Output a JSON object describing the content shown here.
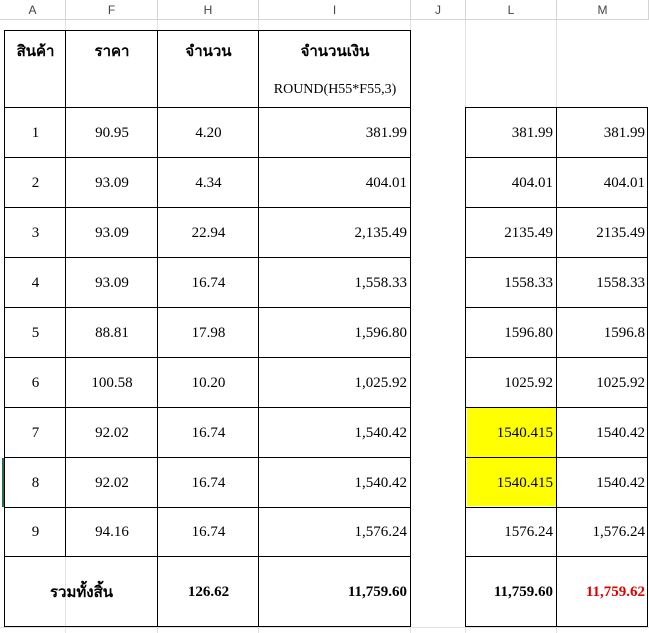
{
  "column_headers": [
    "A",
    "F",
    "H",
    "I",
    "J",
    "L",
    "M"
  ],
  "table": {
    "headers": {
      "product": "สินค้า",
      "price": "ราคา",
      "quantity": "จำนวน",
      "amount": "จำนวนเงิน",
      "formula_note": "ROUND(H55*F55,3)"
    },
    "rows": [
      {
        "item": "1",
        "price": "90.95",
        "qty": "4.20",
        "amount": "381.99",
        "l": "381.99",
        "m": "381.99"
      },
      {
        "item": "2",
        "price": "93.09",
        "qty": "4.34",
        "amount": "404.01",
        "l": "404.01",
        "m": "404.01"
      },
      {
        "item": "3",
        "price": "93.09",
        "qty": "22.94",
        "amount": "2,135.49",
        "l": "2135.49",
        "m": "2135.49"
      },
      {
        "item": "4",
        "price": "93.09",
        "qty": "16.74",
        "amount": "1,558.33",
        "l": "1558.33",
        "m": "1558.33"
      },
      {
        "item": "5",
        "price": "88.81",
        "qty": "17.98",
        "amount": "1,596.80",
        "l": "1596.80",
        "m": "1596.8"
      },
      {
        "item": "6",
        "price": "100.58",
        "qty": "10.20",
        "amount": "1,025.92",
        "l": "1025.92",
        "m": "1025.92"
      },
      {
        "item": "7",
        "price": "92.02",
        "qty": "16.74",
        "amount": "1,540.42",
        "l": "1540.415",
        "m": "1540.42"
      },
      {
        "item": "8",
        "price": "92.02",
        "qty": "16.74",
        "amount": "1,540.42",
        "l": "1540.415",
        "m": "1540.42"
      },
      {
        "item": "9",
        "price": "94.16",
        "qty": "16.74",
        "amount": "1,576.24",
        "l": "1576.24",
        "m": "1,576.24"
      }
    ],
    "total": {
      "label": "รวมทั้งสิ้น",
      "qty": "126.62",
      "amount": "11,759.60",
      "l": "11,759.60",
      "m": "11,759.62"
    }
  },
  "colors": {
    "highlight": "#ffff00",
    "total_m_text": "#e00000",
    "active_row_marker": "#217346"
  }
}
